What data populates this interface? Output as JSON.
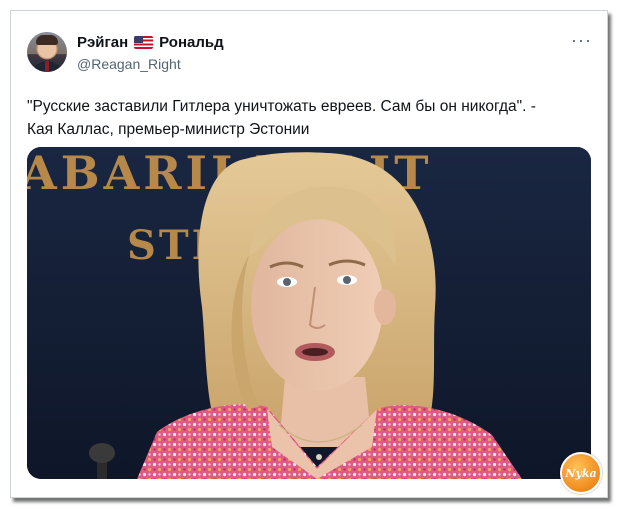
{
  "post": {
    "author_name_part1": "Рэйган",
    "flag_icon": "us-flag-icon",
    "author_name_part2": "Рональд",
    "handle": "@Reagan_Right",
    "more_icon": "···",
    "text_line1": "\"Русские заставили Гитлера уничтожать евреев. Сам бы он никогда\". -",
    "text_line2": "Кая Каллас, премьер-министр Эстонии"
  },
  "media": {
    "backdrop_text_top": "ABARII  VALIT",
    "backdrop_text_bottom": "STEN          MAJA"
  },
  "watermark": {
    "text": "Nyka"
  },
  "colors": {
    "backdrop": "#152035",
    "backdrop_lettering": "#b6894a",
    "text_primary": "#0f1419",
    "text_secondary": "#536471",
    "watermark": "#f08a1c"
  }
}
